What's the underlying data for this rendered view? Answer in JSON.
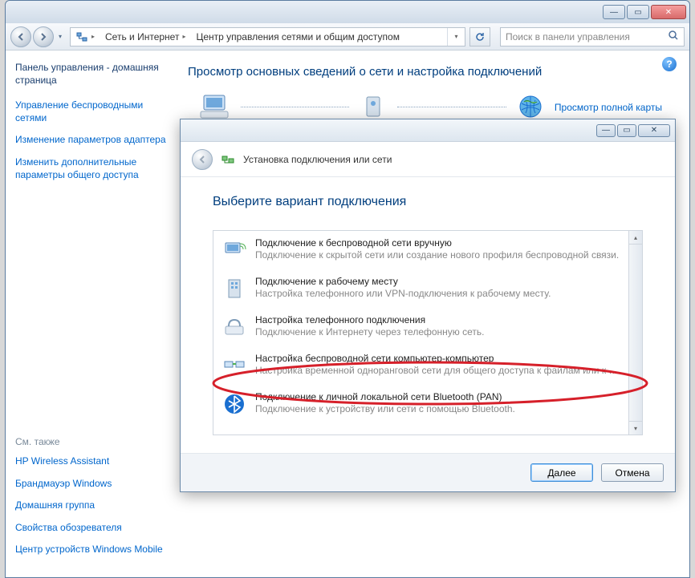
{
  "titlebar": {
    "min": "—",
    "max": "▭",
    "close": "✕"
  },
  "nav": {
    "segments": [
      "Сеть и Интернет",
      "Центр управления сетями и общим доступом"
    ],
    "search_placeholder": "Поиск в панели управления"
  },
  "sidebar": {
    "home": "Панель управления - домашняя страница",
    "links": [
      "Управление беспроводными сетями",
      "Изменение параметров адаптера",
      "Изменить дополнительные параметры общего доступа"
    ],
    "see_also_label": "См. также",
    "see_also": [
      "HP Wireless Assistant",
      "Брандмауэр Windows",
      "Домашняя группа",
      "Свойства обозревателя",
      "Центр устройств Windows Mobile"
    ]
  },
  "main": {
    "heading": "Просмотр основных сведений о сети и настройка подключений",
    "full_map": "Просмотр полной карты"
  },
  "wizard": {
    "window_title": "Установка подключения или сети",
    "heading": "Выберите вариант подключения",
    "options": [
      {
        "title": "Подключение к беспроводной сети вручную",
        "subtitle": "Подключение к скрытой сети или создание нового профиля беспроводной связи."
      },
      {
        "title": "Подключение к рабочему месту",
        "subtitle": "Настройка телефонного или VPN-подключения к рабочему месту."
      },
      {
        "title": "Настройка телефонного подключения",
        "subtitle": "Подключение к Интернету через телефонную сеть."
      },
      {
        "title": "Настройка беспроводной сети компьютер-компьютер",
        "subtitle": "Настройка временной одноранговой сети для общего доступа к файлам или к Инт..."
      },
      {
        "title": "Подключение к личной локальной сети Bluetooth (PAN)",
        "subtitle": "Подключение к устройству или сети с помощью Bluetooth."
      }
    ],
    "next": "Далее",
    "cancel": "Отмена"
  }
}
